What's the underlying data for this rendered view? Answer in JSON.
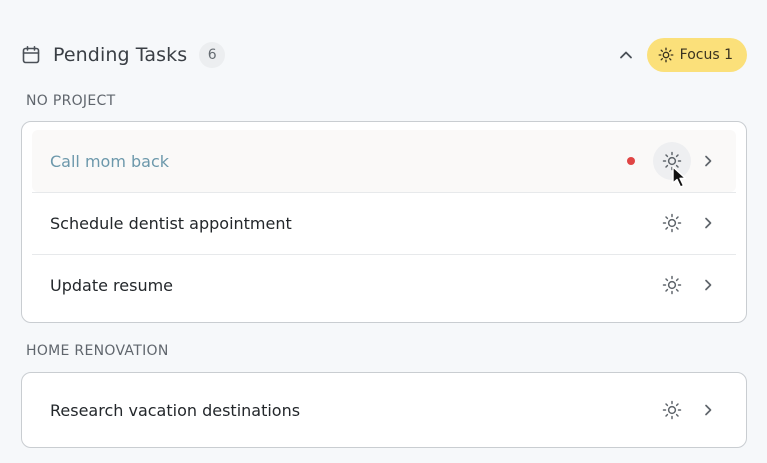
{
  "header": {
    "icon": "calendar-icon",
    "title": "Pending Tasks",
    "count": "6",
    "collapse_icon": "chevron-up-icon",
    "focus_label": "Focus 1",
    "focus_icon": "sun-icon",
    "focus_color": "#fbe07a"
  },
  "sections": [
    {
      "label": "NO PROJECT",
      "tasks": [
        {
          "title": "Call mom back",
          "has_dot": true,
          "dot_color": "#e04545"
        },
        {
          "title": "Schedule dentist appointment"
        },
        {
          "title": "Update resume"
        }
      ]
    },
    {
      "label": "HOME RENOVATION",
      "tasks": [
        {
          "title": "Research vacation destinations"
        }
      ]
    }
  ]
}
